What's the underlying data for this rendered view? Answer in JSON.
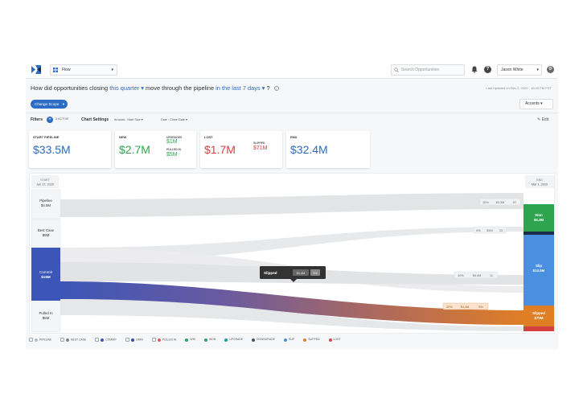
{
  "header": {
    "flow_select": "Flow",
    "search_placeholder": "Search Opportunities",
    "user": "Jason White"
  },
  "question": {
    "part1": "How did opportunities closing",
    "scope": "this quarter",
    "part2": "move through the pipeline",
    "range": "in the last 7 days",
    "part3": "?",
    "last_updated": "Last Updated on Dec 2, 2020 · 10:45 PM PST"
  },
  "toolbar": {
    "change_scope": "Change Scope",
    "accents": "Accents"
  },
  "filters": {
    "label": "Filters",
    "count": "3 ACTIVE",
    "chart_settings": "Chart Settings",
    "amount": "Amount : Start Size",
    "date": "Date : Close Date",
    "edit": "Edit"
  },
  "cards": {
    "start": {
      "label": "START PIPELINE",
      "value": "$33.5M"
    },
    "new": {
      "label": "NEW",
      "value": "$2.7M",
      "upgrades_label": "UPGRADES",
      "upgrades_value": "$1M",
      "pulled_label": "PULLED IN",
      "pulled_value": "$5M"
    },
    "lost": {
      "label": "LOST",
      "value": "$1.7M",
      "slipped_label": "SLIPPED",
      "slipped_value": "$71M"
    },
    "end": {
      "label": "END",
      "value": "$32.4M"
    }
  },
  "sankey": {
    "start_header": {
      "label": "START",
      "date": "Jan 17, 2020"
    },
    "end_header": {
      "label": "END",
      "date": "Mar 1, 2020"
    },
    "nodes_left": [
      {
        "name": "Pipeline",
        "value": "$4.5M"
      },
      {
        "name": "Best Case",
        "value": "$9M"
      },
      {
        "name": "Commit",
        "value": "$16M"
      },
      {
        "name": "Pulled In",
        "value": "$5M"
      }
    ],
    "nodes_right": [
      {
        "name": "Won",
        "value": "$6.3M"
      },
      {
        "name": "Slip",
        "value": "$14.5M"
      },
      {
        "name": "Slipped",
        "value": "$70M"
      }
    ],
    "tooltip": {
      "label": "Slipped",
      "value": "$4.4M",
      "pct": "9%"
    },
    "flow_labels": {
      "won": [
        "20%",
        "$3.3M",
        "57"
      ],
      "mid": [
        "6%",
        "$1M",
        "23"
      ],
      "slip": [
        "40%",
        "$6.4M",
        "11"
      ],
      "slipped": [
        "22%",
        "$4.4M",
        "9%"
      ]
    }
  },
  "legend": [
    {
      "label": "PIPELINE",
      "color": "#b6bcc6",
      "cb": true
    },
    {
      "label": "BEST CASE",
      "color": "#7c8592",
      "cb": true
    },
    {
      "label": "COMMIT",
      "color": "#3a55b4",
      "cb": true
    },
    {
      "label": "OMNI",
      "color": "#3f4a9a",
      "cb": true
    },
    {
      "label": "PULLED IN",
      "color": "#e05a5a",
      "cb": true
    },
    {
      "label": "WIN",
      "color": "#2ea36e",
      "cb": false
    },
    {
      "label": "WON",
      "color": "#2ea36e",
      "cb": false
    },
    {
      "label": "UPGRADE",
      "color": "#18a0a0",
      "cb": false
    },
    {
      "label": "DOWNGRADE",
      "color": "#456",
      "cb": false
    },
    {
      "label": "SLIP",
      "color": "#4a90e2",
      "cb": false
    },
    {
      "label": "SLIPPED",
      "color": "#e0812e",
      "cb": false
    },
    {
      "label": "LOST",
      "color": "#d94848",
      "cb": false
    }
  ],
  "colors": {
    "accent": "#2b6cc4",
    "commit": "#3b56b6",
    "won": "#2ea44f",
    "slip": "#4a8fe0",
    "slipped": "#e07e26",
    "lost": "#d64040",
    "green_text": "#2ea44f",
    "red_text": "#d64040"
  }
}
